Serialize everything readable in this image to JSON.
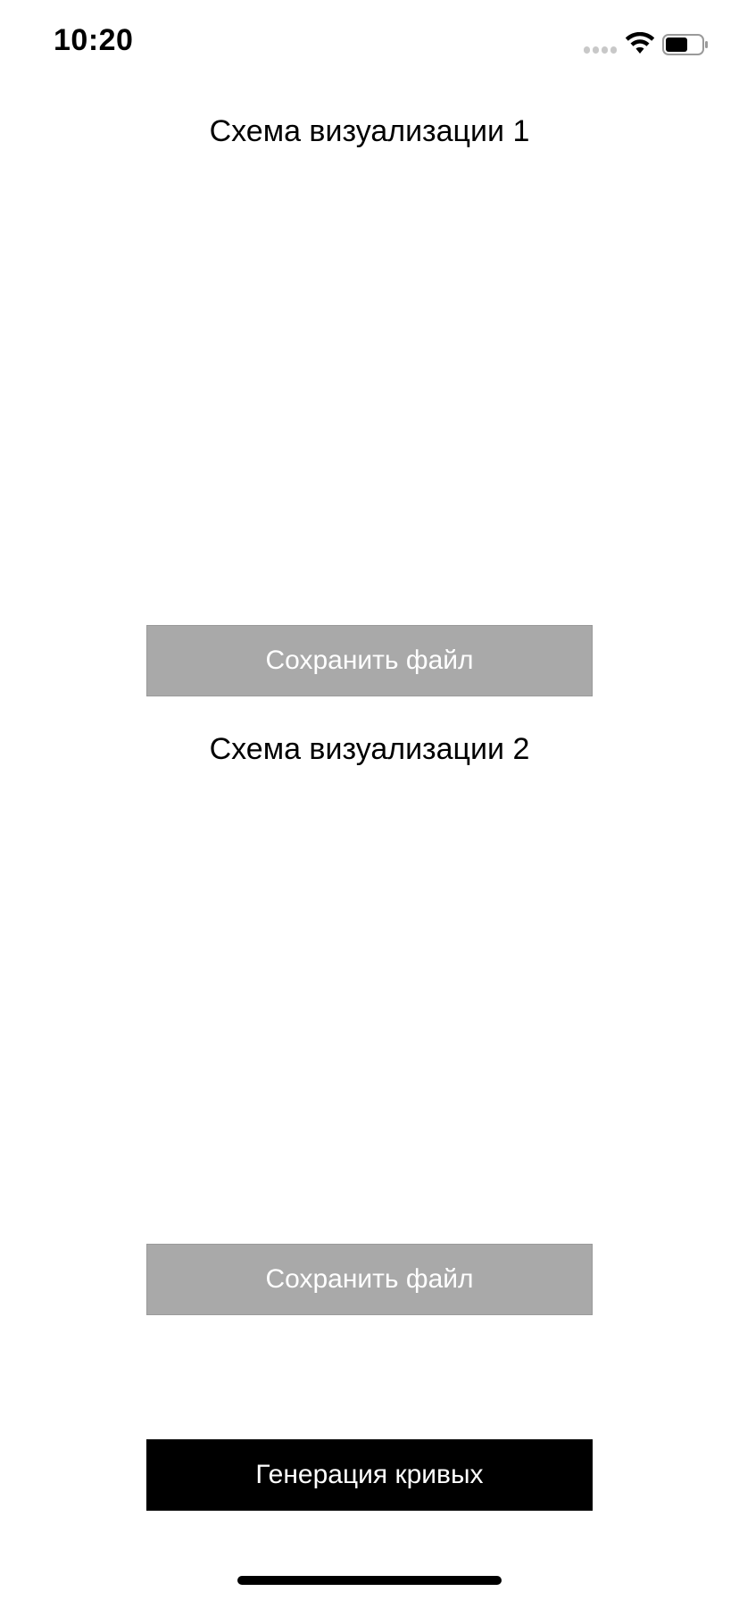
{
  "status_bar": {
    "time": "10:20",
    "icons": [
      "signal-dots-icon",
      "wifi-icon",
      "battery-icon"
    ]
  },
  "section_1": {
    "title": "Схема визуализации 1",
    "save_label": "Сохранить файл"
  },
  "section_2": {
    "title": "Схема визуализации 2",
    "save_label": "Сохранить файл"
  },
  "generate_label": "Генерация кривых",
  "colors": {
    "save_button_bg": "#a9a9a9",
    "generate_button_bg": "#000000",
    "background": "#ffffff"
  }
}
